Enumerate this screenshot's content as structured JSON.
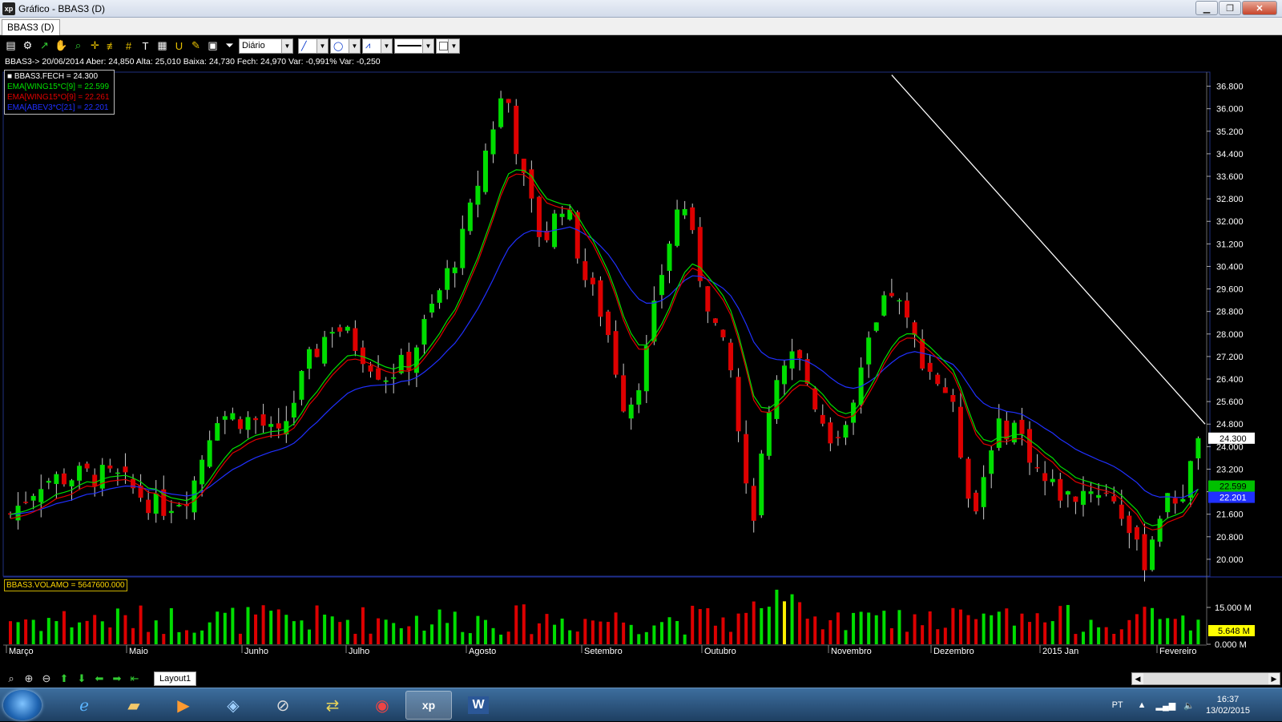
{
  "window": {
    "title": "Gráfico - BBAS3 (D)",
    "app_icon": "xp-icon",
    "buttons": [
      "minimize-icon",
      "restore-icon",
      "close-icon"
    ]
  },
  "tab": {
    "label": "BBAS3 (D)"
  },
  "toolbar": {
    "period": "Diário",
    "tools": [
      "chart-type-icon",
      "settings-gear-icon",
      "draw-line-icon",
      "hand-icon",
      "zoom-area-icon",
      "crosshair-icon",
      "fibonacci-icon",
      "grid-icon",
      "text-icon",
      "calculator-icon",
      "magnet-icon",
      "brush-icon",
      "clipboard-icon",
      "filter-icon"
    ]
  },
  "infoline": "BBAS3-> 20/06/2014 Aber: 24,850 Alta: 25,010 Baixa: 24,730 Fech: 24,970 Var: -0,991% Var: -0,250",
  "legend": [
    {
      "text": "■ BBAS3.FECH = 24.300",
      "color": "#ffffff"
    },
    {
      "text": "EMA[WING15*C[9] = 22.599",
      "color": "#00e000"
    },
    {
      "text": "EMA[WING15*O[9] = 22.261",
      "color": "#e00000"
    },
    {
      "text": "EMA[ABEV3*C[21] = 22.201",
      "color": "#2030ff"
    }
  ],
  "volume_legend": "BBAS3.VOLAMO = 5647600.000",
  "price_axis": {
    "ticks": [
      "36.800",
      "36.000",
      "35.200",
      "34.400",
      "33.600",
      "32.800",
      "32.000",
      "31.200",
      "30.400",
      "29.600",
      "28.800",
      "28.000",
      "27.200",
      "26.400",
      "25.600",
      "24.800",
      "24.000",
      "23.200",
      "22.400",
      "21.600",
      "20.800",
      "20.000"
    ],
    "last_price": "24.300",
    "ema_fast": "22.599",
    "ema_slow": "22.201"
  },
  "volume_axis": {
    "ticks": [
      "15.000 M",
      "0.000 M"
    ],
    "last": "5.648 M"
  },
  "months": [
    "Março",
    "Maio",
    "Junho",
    "Julho",
    "Agosto",
    "Setembro",
    "Outubro",
    "Novembro",
    "Dezembro",
    "2015 Jan",
    "Fevereiro"
  ],
  "bottom": {
    "layout_tab": "Layout1"
  },
  "colors": {
    "up": "#00dd00",
    "down": "#dd0000",
    "ema_c": "#00e000",
    "ema_o": "#e00000",
    "ema_blue": "#2030ff",
    "trendline": "#ffffff",
    "volume_highlight": "#ffee00"
  },
  "taskbar": {
    "apps": [
      "ie-icon",
      "folder-icon",
      "media-player-icon",
      "network-icon",
      "hp-icon",
      "file-transfer-icon",
      "chrome-icon",
      "xp-icon",
      "word-icon"
    ],
    "active_app": "xp-icon",
    "lang": "PT",
    "time": "16:37",
    "date": "13/02/2015"
  },
  "chart_data": {
    "type": "candlestick",
    "symbol": "BBAS3",
    "ylim": [
      19.4,
      37.3
    ],
    "price_path_approx": [
      {
        "x": "Março",
        "y": 21.6
      },
      {
        "x": "Maio",
        "y": 23.0
      },
      {
        "x": "Junho",
        "y": 21.8
      },
      {
        "x": "Julho",
        "y": 24.8
      },
      {
        "x": "Agosto",
        "y": 28.4
      },
      {
        "x": "Agosto",
        "y": 26.5
      },
      {
        "x": "Setembro",
        "y": 36.8
      },
      {
        "x": "Setembro",
        "y": 31.2
      },
      {
        "x": "Outubro",
        "y": 25.2
      },
      {
        "x": "Outubro",
        "y": 33.0
      },
      {
        "x": "Outubro",
        "y": 26.5
      },
      {
        "x": "Novembro",
        "y": 21.0
      },
      {
        "x": "Novembro",
        "y": 27.5
      },
      {
        "x": "Novembro",
        "y": 24.5
      },
      {
        "x": "Dezembro",
        "y": 29.5
      },
      {
        "x": "Dezembro",
        "y": 26.2
      },
      {
        "x": "Dezembro",
        "y": 21.5
      },
      {
        "x": "2015 Jan",
        "y": 24.5
      },
      {
        "x": "2015 Jan",
        "y": 22.0
      },
      {
        "x": "2015 Jan",
        "y": 22.5
      },
      {
        "x": "Fevereiro",
        "y": 20.2
      },
      {
        "x": "Fevereiro",
        "y": 22.0
      },
      {
        "x": "Fevereiro",
        "y": 24.3
      }
    ],
    "last_close": 24.3,
    "ema_c9": 22.599,
    "ema_o9": 22.261,
    "ema_21": 22.201,
    "volume_last_millions": 5.648,
    "grid": false
  }
}
